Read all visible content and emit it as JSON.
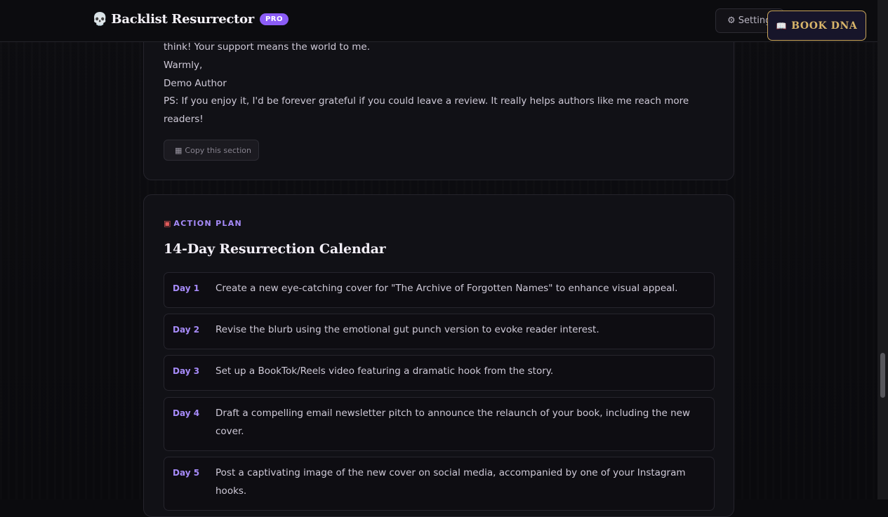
{
  "header": {
    "brand_icon": "skull-icon",
    "brand_title": "Backlist Resurrector",
    "badge": "PRO",
    "settings_label": "Setting",
    "book_dna_label": "BOOK DNA"
  },
  "letter": {
    "lines": [
      "think! Your support means the world to me.",
      "Warmly,",
      "Demo Author",
      "PS: If you enjoy it, I'd be forever grateful if you could leave a review. It really helps authors like me reach more",
      "readers!"
    ],
    "copy_label": "Copy this section"
  },
  "action_plan": {
    "tag": "ACTION PLAN",
    "title": "14-Day Resurrection Calendar",
    "days": [
      {
        "label": "Day 1",
        "text": "Create a new eye-catching cover for \"The Archive of Forgotten Names\" to enhance visual appeal."
      },
      {
        "label": "Day 2",
        "text": "Revise the blurb using the emotional gut punch version to evoke reader interest."
      },
      {
        "label": "Day 3",
        "text": "Set up a BookTok/Reels video featuring a dramatic hook from the story."
      },
      {
        "label": "Day 4",
        "text": "Draft a compelling email newsletter pitch to announce the relaunch of your book, including the new cover."
      },
      {
        "label": "Day 5",
        "text": "Post a captivating image of the new cover on social media, accompanied by one of your Instagram hooks."
      }
    ]
  },
  "colors": {
    "accent": "#a78bfa",
    "badge": "#8b5cf6",
    "gold": "#c9a55a",
    "background": "#0b0b0e"
  }
}
